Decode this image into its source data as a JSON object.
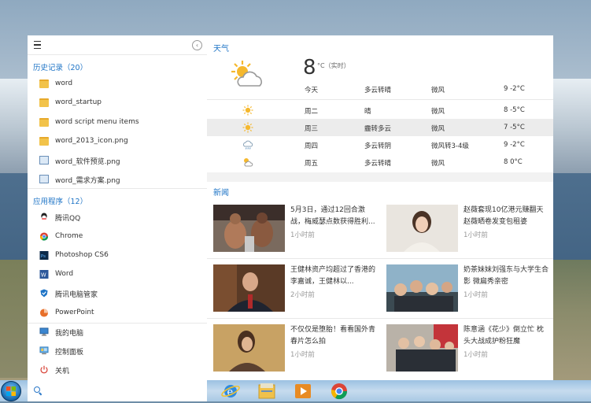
{
  "left": {
    "history_title": "历史记录（20）",
    "history": [
      {
        "label": "word",
        "icon": "folder-icon"
      },
      {
        "label": "word_startup",
        "icon": "folder-icon"
      },
      {
        "label": "word  script  menu  items",
        "icon": "folder-icon"
      },
      {
        "label": "word_2013_icon.png",
        "icon": "folder-icon"
      },
      {
        "label": "word_软件预览.png",
        "icon": "image-file-icon"
      },
      {
        "label": "word_需求方案.png",
        "icon": "image-file-icon"
      }
    ],
    "apps_title": "应用程序（12）",
    "apps": [
      {
        "label": "腾讯QQ",
        "icon": "qq-icon"
      },
      {
        "label": "Chrome",
        "icon": "chrome-icon"
      },
      {
        "label": "Photoshop CS6",
        "icon": "photoshop-icon"
      },
      {
        "label": "Word",
        "icon": "word-icon"
      },
      {
        "label": "腾讯电脑管家",
        "icon": "pc-manager-icon"
      },
      {
        "label": "PowerPoint",
        "icon": "powerpoint-icon"
      }
    ],
    "system": [
      {
        "label": "我的电脑",
        "icon": "computer-icon"
      },
      {
        "label": "控制面板",
        "icon": "control-panel-icon"
      },
      {
        "label": "关机",
        "icon": "power-icon"
      }
    ]
  },
  "weather": {
    "heading": "天气",
    "current_temp": "8",
    "current_unit": "°C（实时）",
    "today": {
      "day": "今天",
      "cond": "多云转晴",
      "wind": "微风",
      "range": "9   -2°C"
    },
    "forecast": [
      {
        "day": "周二",
        "cond": "晴",
        "wind": "微风",
        "range": "8   -5°C",
        "icon": "sun-icon"
      },
      {
        "day": "周三",
        "cond": "霾转多云",
        "wind": "微风",
        "range": "7   -5°C",
        "icon": "sun-icon"
      },
      {
        "day": "周四",
        "cond": "多云转阴",
        "wind": "微风转3-4级",
        "range": "9   -2°C",
        "icon": "cloud-rain-icon"
      },
      {
        "day": "周五",
        "cond": "多云转晴",
        "wind": "微风",
        "range": "8    0°C",
        "icon": "partly-cloudy-icon"
      }
    ]
  },
  "news": {
    "heading": "新闻",
    "items": [
      {
        "title": "5月3日，通过12回合激战，梅威瑟点数获得胜利...",
        "time": "1小时前"
      },
      {
        "title": "赵薇套现10亿港元赚翻天 赵薇晒卷发变包租婆",
        "time": "1小时前"
      },
      {
        "title": "王健林资产均超过了香港的李嘉诚，王健林以...",
        "time": "2小时前"
      },
      {
        "title": "奶茶妹妹刘强东与大学生合影 微扁秀亲密",
        "time": "1小时前"
      },
      {
        "title": "不仅仅是堕胎！看看国外青春片怎么拍",
        "time": "1小时前"
      },
      {
        "title": "陈意涵《花少》倒立忙 枕头大战成护粉狂魔",
        "time": "1小时前"
      }
    ]
  },
  "colors": {
    "accent": "#1e74c6",
    "highlight_row": "#ececec"
  }
}
